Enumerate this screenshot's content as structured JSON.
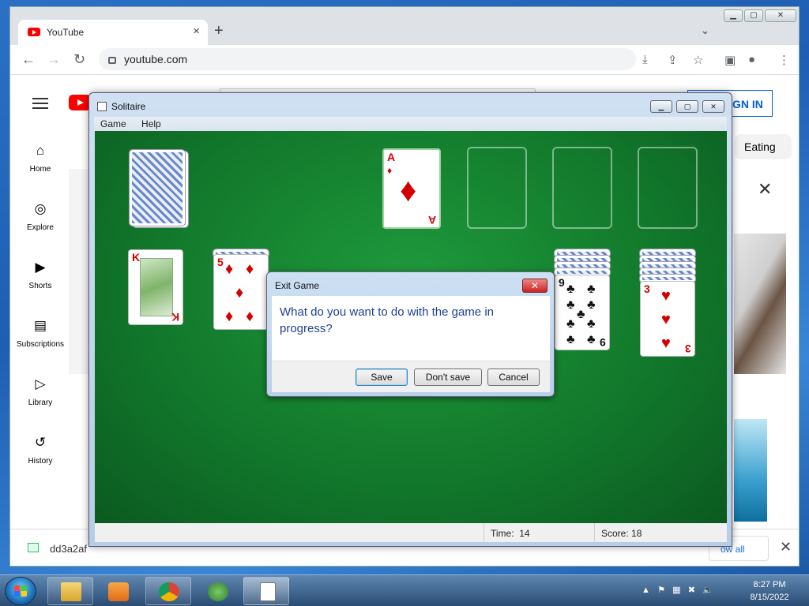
{
  "browser": {
    "tab_title": "YouTube",
    "tab_close": "×",
    "new_tab": "+",
    "url": "youtube.com"
  },
  "youtube": {
    "sign_in": "GN IN",
    "sidebar": [
      {
        "label": "Home",
        "icon": "home-icon"
      },
      {
        "label": "Explore",
        "icon": "compass-icon"
      },
      {
        "label": "Shorts",
        "icon": "shorts-icon"
      },
      {
        "label": "Subscriptions",
        "icon": "subscriptions-icon"
      },
      {
        "label": "Library",
        "icon": "library-icon"
      },
      {
        "label": "History",
        "icon": "history-icon"
      }
    ],
    "chip": "Eating",
    "download_name": "dd3a2af",
    "show_all": "ow all"
  },
  "solitaire": {
    "title": "Solitaire",
    "menu": [
      "Game",
      "Help"
    ],
    "time_label": "Time:",
    "time_value": "14",
    "score_label": "Score:",
    "score_value": "18",
    "cards": {
      "foundation_ace": {
        "rank": "A",
        "suit": "♦"
      },
      "king": {
        "rank": "K",
        "suit": "♦"
      },
      "five": {
        "rank": "5",
        "suit": "♦"
      },
      "nine": {
        "rank": "9",
        "suit": "♣"
      },
      "three": {
        "rank": "3",
        "suit": "♥"
      }
    }
  },
  "dialog": {
    "title": "Exit Game",
    "close": "✕",
    "message": "What do you want to do with the game in progress?",
    "save": "Save",
    "dont_save": "Don't save",
    "cancel": "Cancel"
  },
  "taskbar": {
    "time": "8:27 PM",
    "date": "8/15/2022"
  }
}
